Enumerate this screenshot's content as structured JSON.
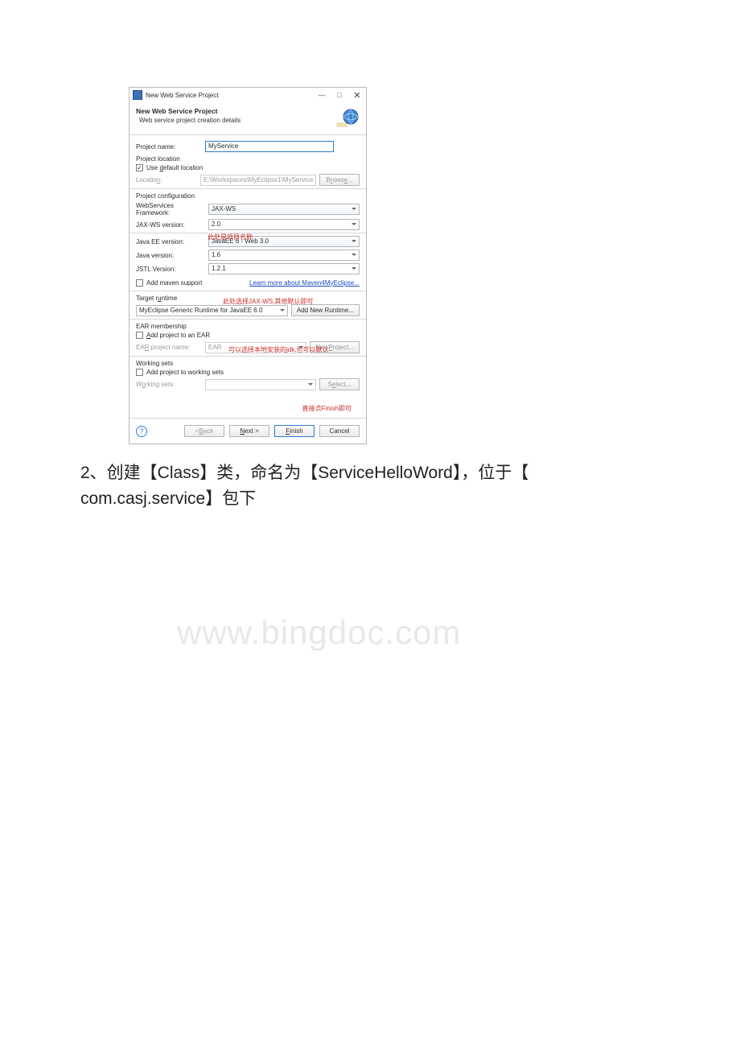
{
  "titlebar": {
    "title": "New Web Service Project",
    "minimize": "—",
    "maximize": "□",
    "close": "✕"
  },
  "header": {
    "title": "New Web Service Project",
    "subtitle": "Web service project creation details"
  },
  "project": {
    "name_label": "Project name:",
    "name_value": "MyService",
    "loc_section": "Project location",
    "use_default_label": "Use default location",
    "location_label": "Location:",
    "location_value": "E:\\Workspaces\\MyEclipse1\\MyService",
    "browse_btn": "Browse..."
  },
  "config": {
    "section": "Project configuration",
    "ws_framework_label": "WebServices Framework:",
    "ws_framework_value": "JAX-WS",
    "jaxws_label": "JAX-WS version:",
    "jaxws_value": "2.0",
    "javaee_label": "Java EE version:",
    "javaee_value": "JavaEE 6 - Web 3.0",
    "java_label": "Java version:",
    "java_value": "1.6",
    "jstl_label": "JSTL Version:",
    "jstl_value": "1.2.1",
    "maven_label": "Add maven support",
    "maven_link": "Learn more about Maven4MyEclipse..."
  },
  "runtime": {
    "section": "Target runtime",
    "value": "MyEclipse Generic Runtime for JavaEE 6.0",
    "add_btn": "Add New Runtime..."
  },
  "ear": {
    "section": "EAR membership",
    "add_label": "Add project to an EAR",
    "name_label": "EAR project name:",
    "name_value": "EAR",
    "new_btn": "New Project..."
  },
  "ws": {
    "section": "Working sets",
    "add_label": "Add project to working sets",
    "label": "Working sets:",
    "select_btn": "Select..."
  },
  "footer": {
    "help": "?",
    "back": "< Back",
    "next": "Next >",
    "finish": "Finish",
    "cancel": "Cancel"
  },
  "annotations": {
    "name": "此处是项目名称",
    "framework": "此处选择JAX-WS,其他默认即可",
    "java": "可以选择本地安装的jdk,也可以默认",
    "finish_note": "直接点Finish即可"
  },
  "body_text": {
    "line1_prefix": "2、创建【Class】类，命名为【ServiceHelloWord】，位于【",
    "line2": "com.casj.service】包下"
  },
  "watermark": "www.bingdoc.com"
}
